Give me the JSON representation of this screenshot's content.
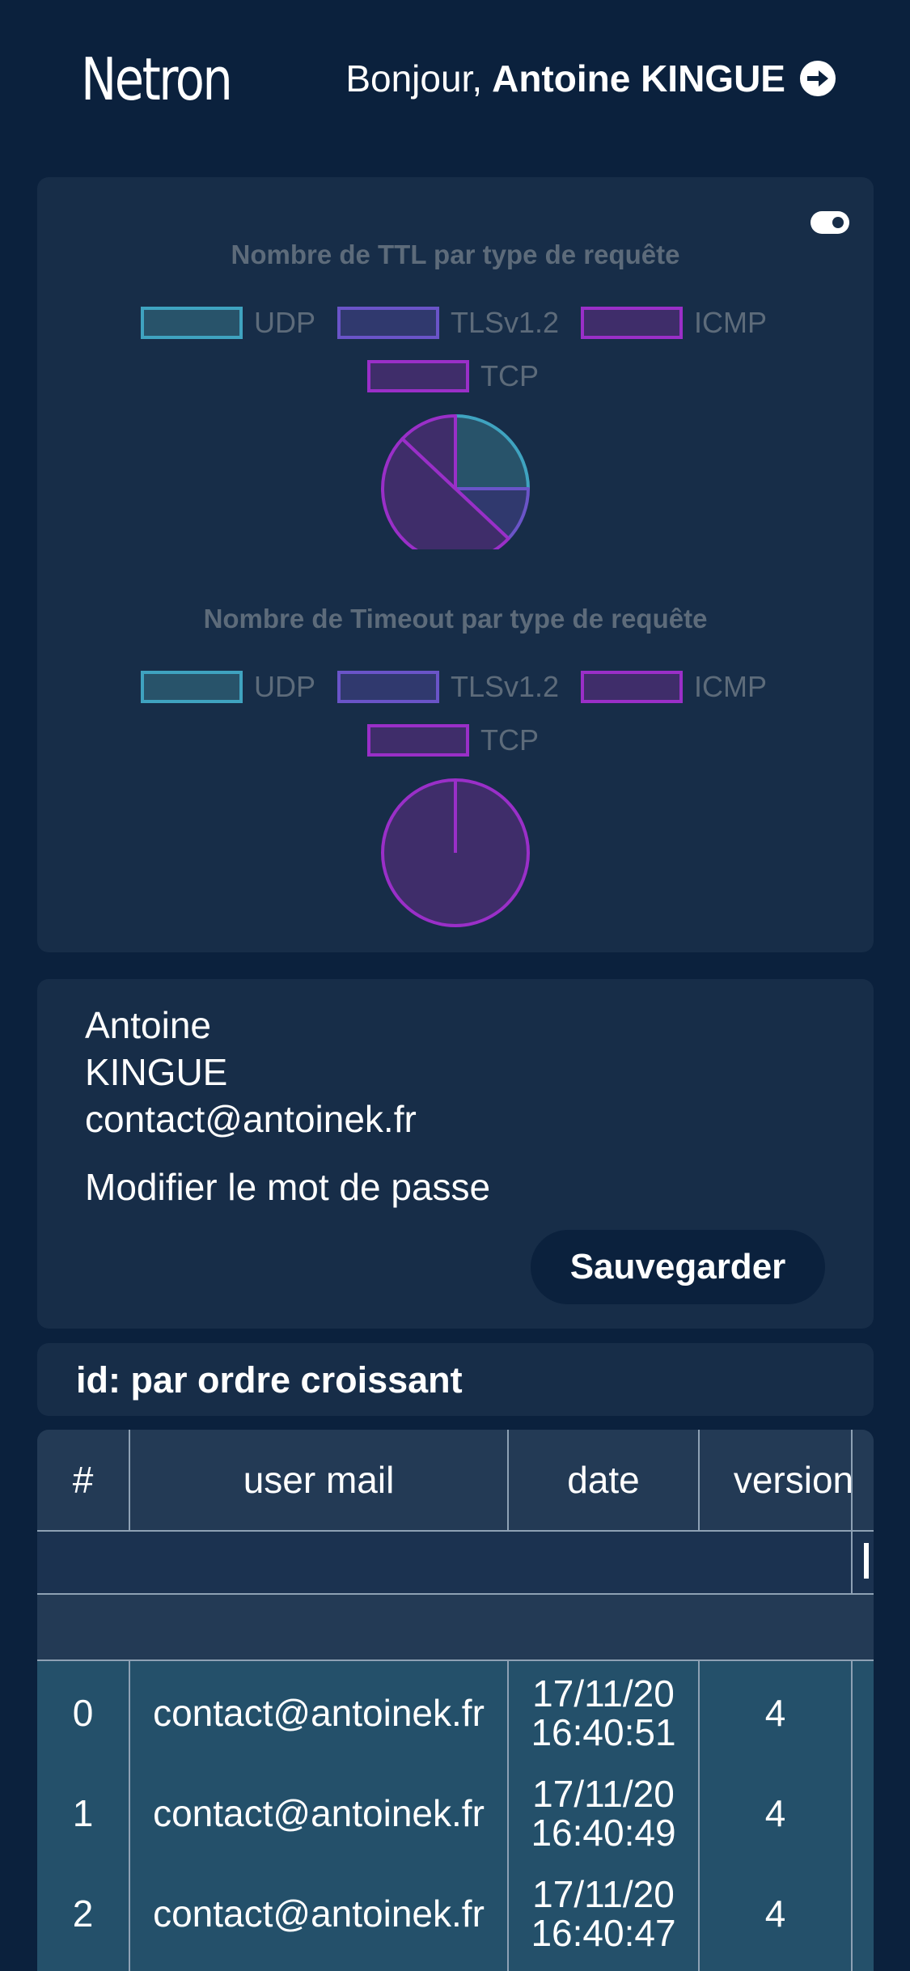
{
  "header": {
    "logo": "Netron",
    "greeting_prefix": "Bonjour, ",
    "user_name": "Antoine KINGUE",
    "logout_icon": "logout-arrow-icon"
  },
  "charts": [
    {
      "title": "Nombre de TTL par type de requête",
      "legend": [
        {
          "label": "UDP",
          "color": "#3fa3c0"
        },
        {
          "label": "TLSv1.2",
          "color": "#6a54c8"
        },
        {
          "label": "ICMP",
          "color": "#9a2fc8"
        },
        {
          "label": "TCP",
          "color": "#9a2fc8"
        }
      ]
    },
    {
      "title": "Nombre de Timeout par type de requête",
      "legend": [
        {
          "label": "UDP",
          "color": "#3fa3c0"
        },
        {
          "label": "TLSv1.2",
          "color": "#6a54c8"
        },
        {
          "label": "ICMP",
          "color": "#9a2fc8"
        },
        {
          "label": "TCP",
          "color": "#9a2fc8"
        }
      ]
    }
  ],
  "chart_data": [
    {
      "type": "pie",
      "title": "Nombre de TTL par type de requête",
      "categories": [
        "UDP",
        "TLSv1.2",
        "ICMP",
        "TCP"
      ],
      "values": [
        25,
        12,
        50,
        13
      ],
      "legend_position": "top"
    },
    {
      "type": "pie",
      "title": "Nombre de Timeout par type de requête",
      "categories": [
        "UDP",
        "TLSv1.2",
        "ICMP",
        "TCP"
      ],
      "values": [
        0,
        0,
        100,
        0
      ],
      "legend_position": "top"
    }
  ],
  "profile": {
    "first_name": "Antoine",
    "last_name": "KINGUE",
    "email": "contact@antoinek.fr",
    "change_password": "Modifier le mot de passe",
    "save_label": "Sauvegarder"
  },
  "sort": {
    "label": "id: par ordre croissant"
  },
  "table": {
    "headers": [
      "#",
      "user mail",
      "date",
      "version"
    ],
    "rows": [
      {
        "id": "0",
        "mail": "contact@antoinek.fr",
        "date": "17/11/20",
        "time": "16:40:51",
        "version": "4"
      },
      {
        "id": "1",
        "mail": "contact@antoinek.fr",
        "date": "17/11/20",
        "time": "16:40:49",
        "version": "4"
      },
      {
        "id": "2",
        "mail": "contact@antoinek.fr",
        "date": "17/11/20",
        "time": "16:40:47",
        "version": "4"
      }
    ]
  }
}
